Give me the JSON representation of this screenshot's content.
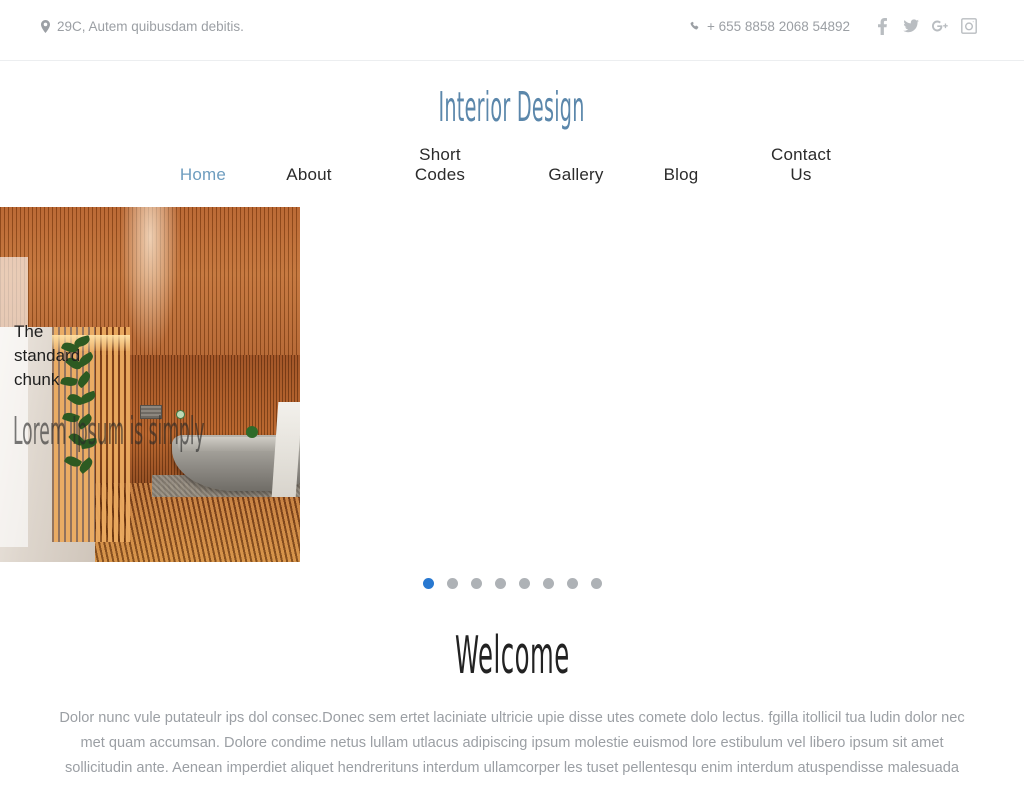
{
  "topbar": {
    "address_icon": "map-marker-icon",
    "address": "29C, Autem quibusdam debitis.",
    "phone_icon": "phone-icon",
    "phone": "+ 655 8858 2068 54892",
    "social": [
      {
        "name": "facebook-icon",
        "label": "f"
      },
      {
        "name": "twitter-icon",
        "label": "t"
      },
      {
        "name": "google-plus-icon",
        "label": "g+"
      },
      {
        "name": "instagram-icon",
        "label": "ig"
      }
    ]
  },
  "brand": {
    "logo_text": "Interior Design",
    "logo_color": "#5b87ab"
  },
  "nav": {
    "items": [
      {
        "label": "Home",
        "active": true
      },
      {
        "label": "About",
        "active": false
      },
      {
        "label": "Short Codes",
        "active": false
      },
      {
        "label": "Gallery",
        "active": false
      },
      {
        "label": "Blog",
        "active": false
      },
      {
        "label": "Contact Us",
        "active": false
      }
    ],
    "active_color": "#6e9dbf"
  },
  "slider": {
    "caption_sub": "The standard chunk",
    "caption_title": "Lorem Ipsum is simply",
    "image_alt": "wooden-slat-bathroom-interior",
    "dots": {
      "count": 8,
      "active_index": 0,
      "active_color": "#2878d0",
      "inactive_color": "#aeb2b6"
    }
  },
  "welcome": {
    "title": "Welcome",
    "paragraph": "Dolor nunc vule putateulr ips dol consec.Donec sem ertet laciniate ultricie upie disse utes comete dolo lectus. fgilla itollicil tua ludin dolor nec met quam accumsan. Dolore condime netus lullam utlacus adipiscing ipsum molestie euismod lore estibulum vel libero ipsum sit amet sollicitudin ante. Aenean imperdiet aliquet hendrerituns interdum ullamcorper les tuset pellentesqu enim interdum atuspendisse malesuada"
  }
}
